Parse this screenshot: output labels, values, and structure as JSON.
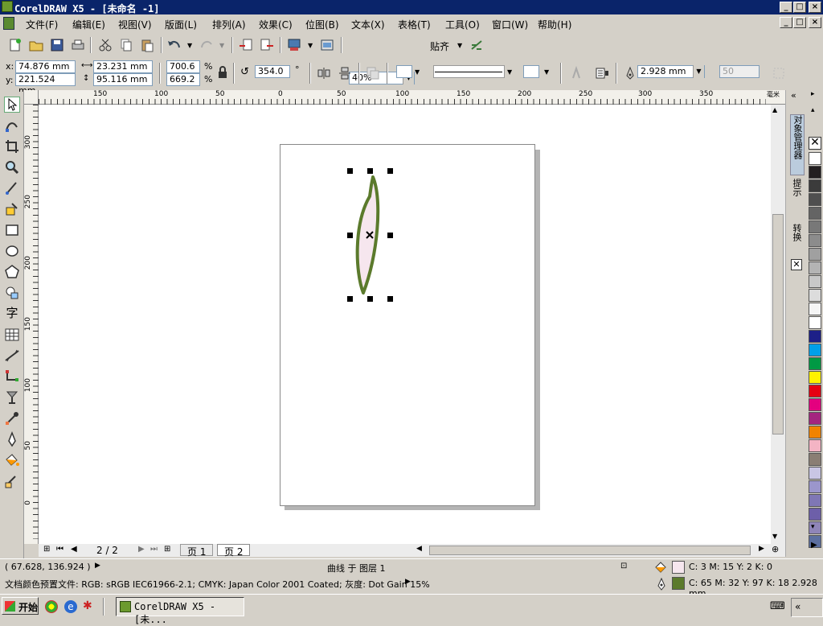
{
  "window": {
    "title": "CorelDRAW X5 - [未命名 -1]",
    "controls": {
      "minimize": "_",
      "maximize": "□",
      "close": "×"
    }
  },
  "menubar": {
    "items": [
      "文件(F)",
      "编辑(E)",
      "视图(V)",
      "版面(L)",
      "排列(A)",
      "效果(C)",
      "位图(B)",
      "文本(X)",
      "表格(T)",
      "工具(O)",
      "窗口(W)",
      "帮助(H)"
    ]
  },
  "standard_toolbar": {
    "zoom_value": "40%",
    "snap_label": "贴齐"
  },
  "property_bar": {
    "x_label": "x:",
    "x_value": "74.876 mm",
    "y_label": "y:",
    "y_value": "221.524 mm",
    "width_value": "23.231 mm",
    "height_value": "95.116 mm",
    "scale_x": "700.6",
    "scale_y": "669.2",
    "percent": "%",
    "rotation_value": "354.0",
    "degree": "°",
    "outline_width": "2.928 mm",
    "nudge_value": "50"
  },
  "rulers": {
    "h_ticks": [
      "150",
      "100",
      "50",
      "0",
      "50",
      "100",
      "150",
      "200",
      "250",
      "300",
      "350"
    ],
    "v_ticks": [
      "300",
      "250",
      "200",
      "150",
      "100",
      "50",
      "0"
    ],
    "unit": "毫米"
  },
  "page_nav": {
    "indicator": "2 / 2",
    "tabs": [
      "页 1",
      "页 2"
    ]
  },
  "docker": {
    "tabs": [
      "对象管理器",
      "提示",
      "转换"
    ]
  },
  "palette": {
    "colors": [
      "#ffffff",
      "#231f20",
      "#3b3b3b",
      "#4f4f4f",
      "#646464",
      "#787878",
      "#8c8c8c",
      "#a0a0a0",
      "#b4b4b4",
      "#c8c8c8",
      "#dcdcdc",
      "#f5f5f5",
      "#ffffff",
      "#1d2088",
      "#00a0e9",
      "#009944",
      "#fff100",
      "#e60012",
      "#e4007f",
      "#a4257f",
      "#f08300",
      "#f4b4c4",
      "#8a7e74",
      "#c9c6e4",
      "#9b96cc",
      "#7f77b5",
      "#6d5fa9",
      "#8f85b8",
      "#5c6fa0"
    ]
  },
  "status": {
    "coords": "( 67.628, 136.924 )",
    "object_info": "曲线 于 图层 1",
    "fill_value": "C: 3 M: 15 Y: 2 K: 0",
    "outline_value": "C: 65 M: 32 Y: 97 K: 18  2.928 mm",
    "profile_text": "文档颜色预置文件: RGB: sRGB IEC61966-2.1; CMYK: Japan Color 2001 Coated; 灰度: Dot Gain 15%",
    "fill_color": "#f6e6ee",
    "outline_color": "#5b7a2c"
  },
  "taskbar": {
    "start_label": "开始",
    "app_button": "CorelDRAW X5 - [未..."
  }
}
